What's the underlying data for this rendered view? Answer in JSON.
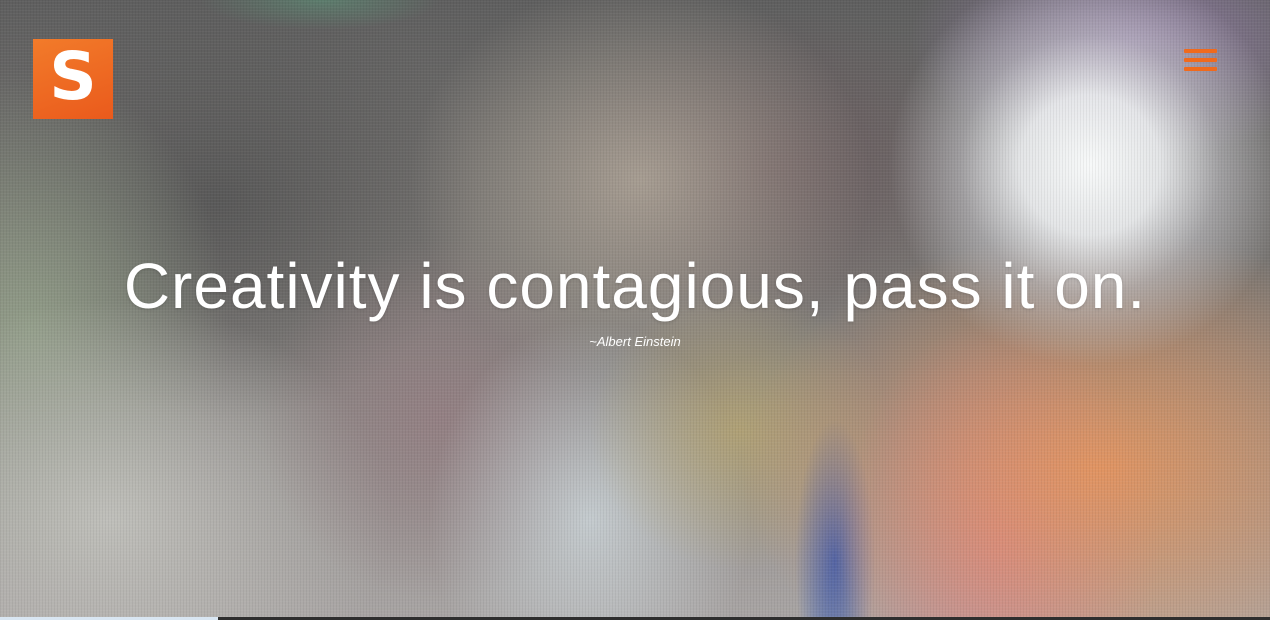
{
  "header": {
    "logo_letter": "S",
    "logo_color": "#f06a1d",
    "menu_icon": "hamburger-menu-icon",
    "menu_color": "#f06a1d"
  },
  "hero": {
    "quote": "Creativity is contagious, pass it on.",
    "author": "~Albert Einstein"
  }
}
